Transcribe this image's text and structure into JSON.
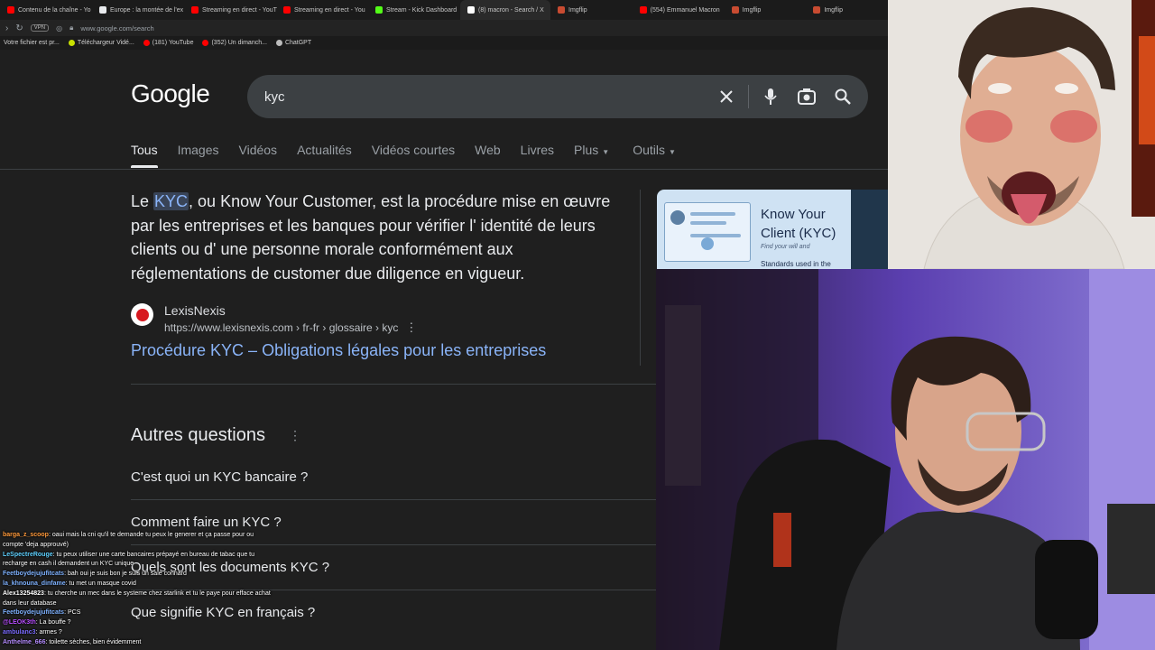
{
  "browser": {
    "tabs": [
      {
        "label": "Contenu de la chaîne - Yo",
        "color": "#ff0000"
      },
      {
        "label": "Europe : la montée de l'ex",
        "color": "#e8eaed"
      },
      {
        "label": "Streaming en direct - YouT",
        "color": "#ff0000"
      },
      {
        "label": "Streaming en direct - You",
        "color": "#ff0000"
      },
      {
        "label": "Stream - Kick Dashboard",
        "color": "#53fc18"
      },
      {
        "label": "(8) macron - Search / X",
        "color": "#ffffff"
      },
      {
        "label": "Imgflip",
        "color": "#c84b31"
      },
      {
        "label": "(554) Emmanuel Macron",
        "color": "#ff0000"
      },
      {
        "label": "Imgflip",
        "color": "#c84b31"
      },
      {
        "label": "Imgflip",
        "color": "#c84b31"
      }
    ],
    "url": "www.google.com/search",
    "vpn_label": "VPN",
    "bookmarks": [
      {
        "label": "Votre fichier est pr...",
        "color": ""
      },
      {
        "label": "Téléchargeur Vidé...",
        "color": "#c8e000"
      },
      {
        "label": "(181) YouTube",
        "color": "#ff0000"
      },
      {
        "label": "(352) Un dimanch...",
        "color": "#ff0000"
      },
      {
        "label": "ChatGPT",
        "color": "#bbbbbb"
      }
    ]
  },
  "google": {
    "logo": "Google",
    "query": "kyc",
    "tabs": [
      "Tous",
      "Images",
      "Vidéos",
      "Actualités",
      "Vidéos courtes",
      "Web",
      "Livres",
      "Plus",
      "Outils"
    ],
    "snippet_before": "Le ",
    "snippet_highlight": "KYC",
    "snippet_after": ", ou Know Your Customer, est la procédure mise en œuvre par les entreprises et les banques pour vérifier l' identité de leurs clients ou d' une personne morale conformément aux réglementations de customer due diligence en vigueur.",
    "source_name": "LexisNexis",
    "source_url": "https://www.lexisnexis.com › fr-fr › glossaire › kyc",
    "result_title": "Procédure KYC – Obligations légales pour les entreprises",
    "image_card": {
      "title_line1": "Know Your",
      "title_line2": "Client (KYC)",
      "subtitle": "Find your will and",
      "caption": "Standards used in the"
    },
    "paa_title": "Autres questions",
    "questions": [
      "C'est quoi un KYC bancaire ?",
      "Comment faire un KYC ?",
      "Quels sont les documents KYC ?",
      "Que signifie KYC en français ?"
    ]
  },
  "chat": [
    {
      "user": "barga_z_scoop",
      "color": "#ff9a3c",
      "text": "oaui mais la cni qu'il te demande tu peux le generer et ça passe pour ou compte 'deja approuvé)"
    },
    {
      "user": "LeSpectreRouge",
      "color": "#5fd1ff",
      "text": "tu peux utiliser une carte bancaires prépayé en bureau de tabac que tu recharge en cash il demandent un KYC unique"
    },
    {
      "user": "Feetboydejujufitcats",
      "color": "#7fb2ff",
      "text": "bah oui je suis bon je suis un sale connard"
    },
    {
      "user": "la_khnouna_dinfame",
      "color": "#7fb2ff",
      "text": "tu met un masque covid"
    },
    {
      "user": "Alex13254823",
      "color": "#ffffff",
      "text": "tu cherche un mec dans le systeme chez starlink et tu le paye pour efface achat dans leur database"
    },
    {
      "user": "Feetboydejujufitcats",
      "color": "#7fb2ff",
      "text": "PCS"
    },
    {
      "user": "@LEOK3th",
      "color": "#b84dff",
      "text": "La bouffe ?"
    },
    {
      "user": "ambulanc3",
      "color": "#7b6bff",
      "text": "armes ?"
    },
    {
      "user": "Anthelme_666",
      "color": "#b58cff",
      "text": "toilette sèches, bien évidemment"
    }
  ]
}
